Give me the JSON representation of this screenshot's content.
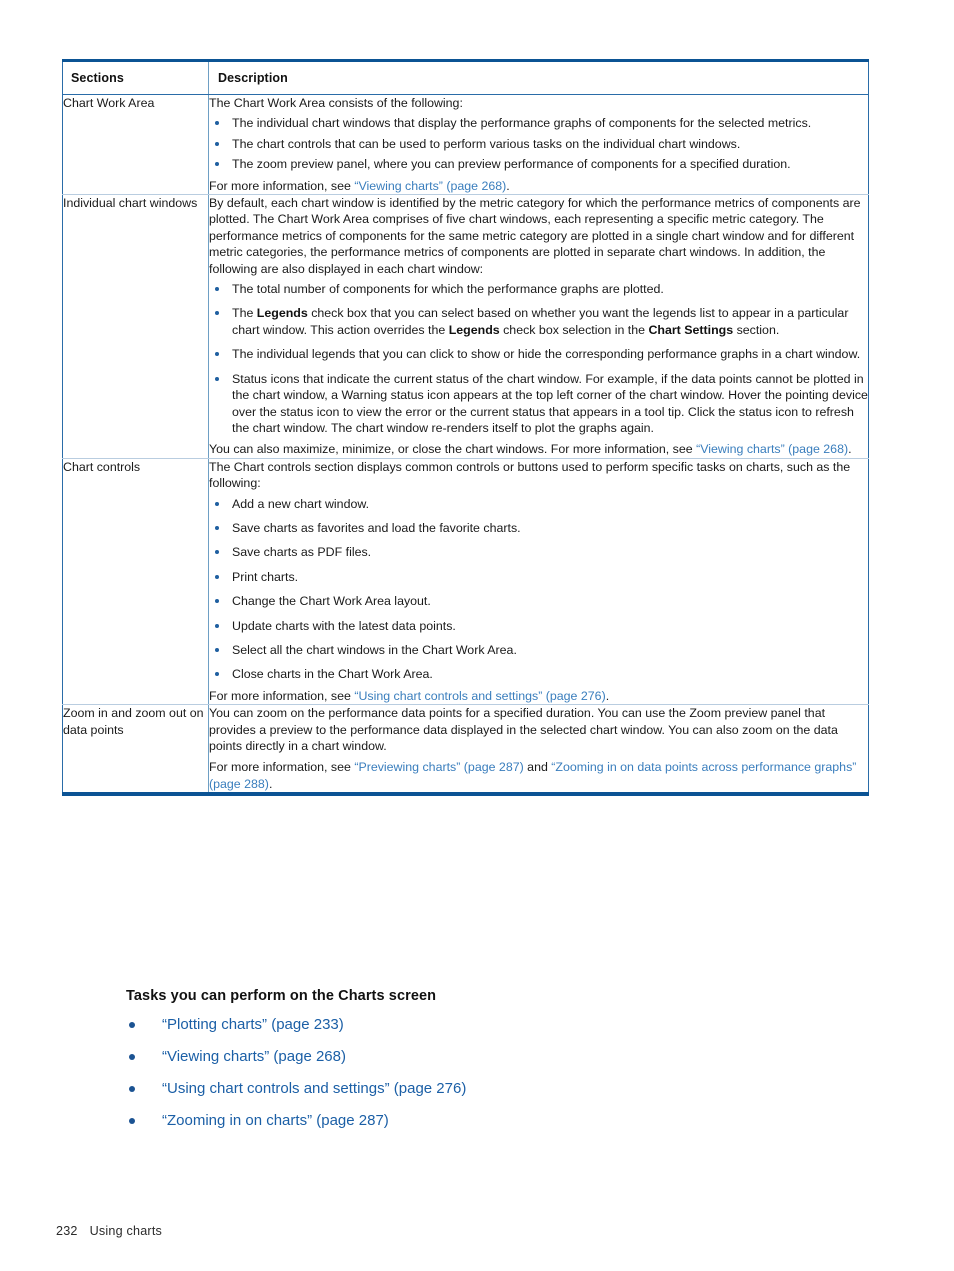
{
  "table": {
    "headers": [
      "Sections",
      "Description"
    ],
    "rows": [
      {
        "section": "Chart Work Area",
        "intro": "The Chart Work Area consists of the following:",
        "bullets": [
          "The individual chart windows that display the performance graphs of components for the selected metrics.",
          "The chart controls that can be used to perform various tasks on the individual chart windows.",
          "The zoom preview panel, where you can preview performance of components for a specified duration."
        ],
        "footer_prefix": "For more information, see ",
        "footer_link": "“Viewing charts” (page 268)",
        "footer_suffix": "."
      },
      {
        "section": "Individual chart windows",
        "intro": "By default, each chart window is identified by the metric category for which the performance metrics of components are plotted. The Chart Work Area comprises of five chart windows, each representing a specific metric category. The performance metrics of components for the same metric category are plotted in a single chart window and for different metric categories, the performance metrics of components are plotted in separate chart windows. In addition, the following are also displayed in each chart window:",
        "bullet1": "The total number of components for which the performance graphs are plotted.",
        "bullet2_a": "The ",
        "bullet2_b": "Legends",
        "bullet2_c": " check box that you can select based on whether you want the legends list to appear in a particular chart window. This action overrides the ",
        "bullet2_d": "Legends",
        "bullet2_e": " check box selection in the ",
        "bullet2_f": "Chart Settings",
        "bullet2_g": " section.",
        "bullet3": "The individual legends that you can click to show or hide the corresponding performance graphs in a chart window.",
        "bullet4": "Status icons that indicate the current status of the chart window. For example, if the data points cannot be plotted in the chart window, a Warning status icon appears at the top left corner of the chart window. Hover the pointing device over the status icon to view the error or the current status that appears in a tool tip. Click the status icon to refresh the chart window. The chart window re-renders itself to plot the graphs again.",
        "footer_prefix": "You can also maximize, minimize, or close the chart windows. For more information, see ",
        "footer_link": "“Viewing charts” (page 268)",
        "footer_suffix": "."
      },
      {
        "section": "Chart controls",
        "intro": "The Chart controls section displays common controls or buttons used to perform specific tasks on charts, such as the following:",
        "bullets": [
          "Add a new chart window.",
          "Save charts as favorites and load the favorite charts.",
          "Save charts as PDF files.",
          "Print charts.",
          "Change the Chart Work Area layout.",
          "Update charts with the latest data points.",
          "Select all the chart windows in the Chart Work Area.",
          "Close charts in the Chart Work Area."
        ],
        "footer_prefix": "For more information, see ",
        "footer_link": "“Using chart controls and settings” (page 276)",
        "footer_suffix": "."
      },
      {
        "section": "Zoom in and zoom out on data points",
        "intro": "You can zoom on the performance data points for a specified duration. You can use the Zoom preview panel that provides a preview to the performance data displayed in the selected chart window. You can also zoom on the data points directly in a chart window.",
        "footer_prefix": "For more information, see ",
        "footer_link1": "“Previewing charts” (page 287)",
        "footer_mid": " and ",
        "footer_link2": "“Zooming in on data points across performance graphs” (page 288)",
        "footer_suffix": "."
      }
    ]
  },
  "tasks": {
    "heading": "Tasks you can perform on the Charts screen",
    "items": [
      "“Plotting charts” (page 233)",
      "“Viewing charts” (page 268)",
      "“Using chart controls and settings” (page 276)",
      "“Zooming in on charts” (page 287)"
    ]
  },
  "footer": {
    "page_number": "232",
    "chapter": "Using charts"
  },
  "colors": {
    "table_border": "#0b5394",
    "link": "#3a7ebd",
    "bullet": "#1f5fa0",
    "task_link": "#1b5fa6"
  }
}
